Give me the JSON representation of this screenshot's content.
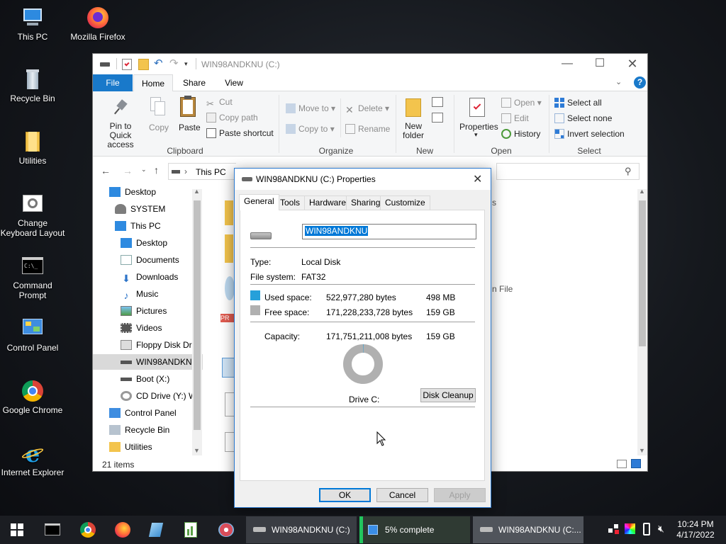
{
  "desktop": {
    "icons": [
      {
        "label": "This PC"
      },
      {
        "label": "Mozilla Firefox"
      },
      {
        "label": "Recycle Bin"
      },
      {
        "label": "Utilities"
      },
      {
        "label": "Change Keyboard Layout"
      },
      {
        "label": "Command Prompt"
      },
      {
        "label": "Control Panel"
      },
      {
        "label": "Google Chrome"
      },
      {
        "label": "Internet Explorer"
      }
    ]
  },
  "explorer": {
    "title": "WIN98ANDKNU (C:)",
    "tabs": {
      "file": "File",
      "home": "Home",
      "share": "Share",
      "view": "View"
    },
    "ribbon": {
      "pin": "Pin to Quick access",
      "copy": "Copy",
      "paste": "Paste",
      "cut": "Cut",
      "copy_path": "Copy path",
      "paste_shortcut": "Paste shortcut",
      "clipboard": "Clipboard",
      "move_to": "Move to",
      "copy_to": "Copy to",
      "delete": "Delete",
      "rename": "Rename",
      "organize": "Organize",
      "new_folder": "New folder",
      "new": "New",
      "properties": "Properties",
      "open_btn": "Open",
      "edit": "Edit",
      "history": "History",
      "open_group": "Open",
      "select_all": "Select all",
      "select_none": "Select none",
      "invert_selection": "Invert selection",
      "select_group": "Select"
    },
    "address": {
      "path": "This PC"
    },
    "nav": [
      {
        "label": "Desktop"
      },
      {
        "label": "SYSTEM"
      },
      {
        "label": "This PC"
      },
      {
        "label": "Desktop"
      },
      {
        "label": "Documents"
      },
      {
        "label": "Downloads"
      },
      {
        "label": "Music"
      },
      {
        "label": "Pictures"
      },
      {
        "label": "Videos"
      },
      {
        "label": "Floppy Disk Dri"
      },
      {
        "label": "WIN98ANDKNU"
      },
      {
        "label": "Boot (X:)"
      },
      {
        "label": "CD Drive (Y:) W"
      },
      {
        "label": "Control Panel"
      },
      {
        "label": "Recycle Bin"
      },
      {
        "label": "Utilities"
      }
    ],
    "partial_text": {
      "s": "s",
      "file": "n File"
    },
    "status": {
      "items": "21 items"
    }
  },
  "dialog": {
    "title": "WIN98ANDKNU (C:) Properties",
    "tabs": [
      "General",
      "Tools",
      "Hardware",
      "Sharing",
      "Customize"
    ],
    "name_value": "WIN98ANDKNU",
    "type_label": "Type:",
    "type_value": "Local Disk",
    "fs_label": "File system:",
    "fs_value": "FAT32",
    "used_label": "Used space:",
    "used_bytes": "522,977,280 bytes",
    "used_size": "498 MB",
    "free_label": "Free space:",
    "free_bytes": "171,228,233,728 bytes",
    "free_size": "159 GB",
    "capacity_label": "Capacity:",
    "capacity_bytes": "171,751,211,008 bytes",
    "capacity_size": "159 GB",
    "drive_label": "Drive C:",
    "cleanup": "Disk Cleanup",
    "ok": "OK",
    "cancel": "Cancel",
    "apply": "Apply",
    "used_fraction": 0.003,
    "used_color": "#26a0da",
    "free_color": "#b0b0b0"
  },
  "taskbar": {
    "tasks": [
      {
        "label": "WIN98ANDKNU (C:)"
      },
      {
        "label": "5% complete"
      },
      {
        "label": "WIN98ANDKNU (C:..."
      }
    ],
    "time": "10:24 PM",
    "date": "4/17/2022"
  }
}
